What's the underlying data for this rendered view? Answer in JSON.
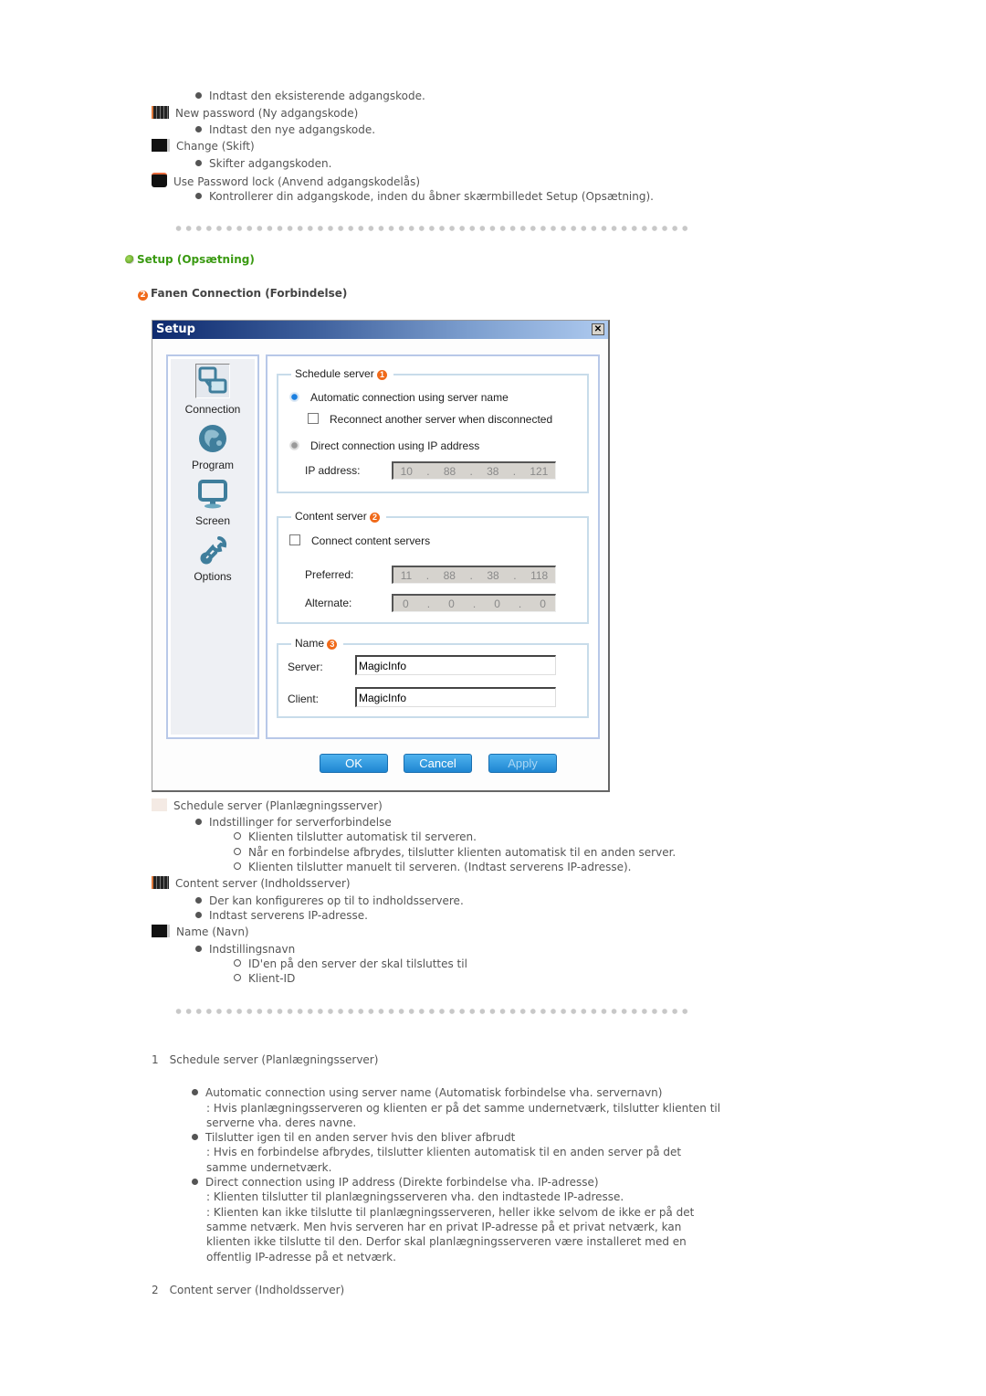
{
  "top_list": [
    {
      "type": "bullet",
      "text": "Indtast den eksisterende adgangskode."
    },
    {
      "type": "item",
      "icon": "new-password-icon",
      "text": "New password (Ny adgangskode)"
    },
    {
      "type": "bullet",
      "text": "Indtast den nye adgangskode."
    },
    {
      "type": "item",
      "icon": "change-icon",
      "text": "Change (Skift)"
    },
    {
      "type": "bullet",
      "text": "Skifter adgangskoden."
    },
    {
      "type": "item",
      "icon": "password-lock-icon",
      "text": "Use Password lock (Anvend adgangskodelås)"
    },
    {
      "type": "bullet",
      "text": "Kontrollerer din adgangskode, inden du åbner skærmbilledet Setup (Opsætning)."
    }
  ],
  "section": {
    "title": "Setup (Opsætning)",
    "subtitle_badge": "2",
    "subtitle": "Fanen Connection (Forbindelse)"
  },
  "dialog": {
    "title": "Setup",
    "close_label": "✕",
    "nav": [
      {
        "label": "Connection",
        "icon": "connection-icon"
      },
      {
        "label": "Program",
        "icon": "globe-icon"
      },
      {
        "label": "Screen",
        "icon": "monitor-icon"
      },
      {
        "label": "Options",
        "icon": "wrench-icon"
      }
    ],
    "schedule": {
      "legend": "Schedule server",
      "badge": "1",
      "auto_label": "Automatic connection using server name",
      "reconnect_label": "Reconnect another server when disconnected",
      "direct_label": "Direct connection using IP address",
      "ip_label": "IP address:",
      "ip": [
        "10",
        "88",
        "38",
        "121"
      ]
    },
    "content": {
      "legend": "Content server",
      "badge": "2",
      "connect_label": "Connect content servers",
      "preferred_label": "Preferred:",
      "preferred": [
        "11",
        "88",
        "38",
        "118"
      ],
      "alternate_label": "Alternate:",
      "alternate": [
        "0",
        "0",
        "0",
        "0"
      ]
    },
    "name": {
      "legend": "Name",
      "badge": "3",
      "server_label": "Server:",
      "server_value": "MagicInfo",
      "client_label": "Client:",
      "client_value": "MagicInfo"
    },
    "buttons": {
      "ok": "OK",
      "cancel": "Cancel",
      "apply": "Apply"
    }
  },
  "mid_list": [
    {
      "type": "item",
      "icon": "schedule-server-icon",
      "text": "Schedule server (Planlægningsserver)"
    },
    {
      "type": "bullet",
      "text": "Indstillinger for serverforbindelse"
    },
    {
      "type": "ring",
      "text": "Klienten tilslutter automatisk til serveren."
    },
    {
      "type": "ring",
      "text": "Når en forbindelse afbrydes, tilslutter klienten automatisk til en anden server."
    },
    {
      "type": "ring",
      "text": "Klienten tilslutter manuelt til serveren. (Indtast serverens IP-adresse)."
    },
    {
      "type": "item",
      "icon": "content-server-icon",
      "text": "Content server (Indholdsserver)"
    },
    {
      "type": "bullet",
      "text": "Der kan konfigureres op til to indholdsservere."
    },
    {
      "type": "bullet",
      "text": "Indtast serverens IP-adresse."
    },
    {
      "type": "item",
      "icon": "name-icon",
      "text": "Name (Navn)"
    },
    {
      "type": "bullet",
      "text": "Indstillingsnavn"
    },
    {
      "type": "ring",
      "text": "ID'en på den server der skal tilsluttes til"
    },
    {
      "type": "ring",
      "text": "Klient-ID"
    }
  ],
  "bottom": {
    "s1_num": "1",
    "s1_title": "Schedule server (Planlægningsserver)",
    "lines": [
      {
        "type": "bullet",
        "text": "Automatic connection using server name (Automatisk forbindelse vha. servernavn)"
      },
      {
        "type": "cont",
        "text": ": Hvis planlægningsserveren og klienten er på det samme undernetværk, tilslutter klienten til"
      },
      {
        "type": "cont",
        "text": "serverne vha. deres navne."
      },
      {
        "type": "bullet",
        "text": "Tilslutter igen til en anden server hvis den bliver afbrudt"
      },
      {
        "type": "cont",
        "text": ": Hvis en forbindelse afbrydes, tilslutter klienten automatisk til en anden server på det"
      },
      {
        "type": "cont",
        "text": "samme undernetværk."
      },
      {
        "type": "bullet",
        "text": "Direct connection using IP address (Direkte forbindelse vha. IP-adresse)"
      },
      {
        "type": "cont",
        "text": ": Klienten tilslutter til planlægningsserveren vha. den indtastede IP-adresse."
      },
      {
        "type": "cont",
        "text": ": Klienten kan ikke tilslutte til planlægningsserveren, heller ikke selvom de ikke er på det"
      },
      {
        "type": "cont",
        "text": "samme netværk. Men hvis serveren har en privat IP-adresse på et privat netværk, kan"
      },
      {
        "type": "cont",
        "text": "klienten ikke tilslutte til den. Derfor skal planlægningsserveren være installeret med en"
      },
      {
        "type": "cont",
        "text": "offentlig IP-adresse på et netværk."
      }
    ],
    "s2_num": "2",
    "s2_title": "Content server (Indholdsserver)"
  }
}
